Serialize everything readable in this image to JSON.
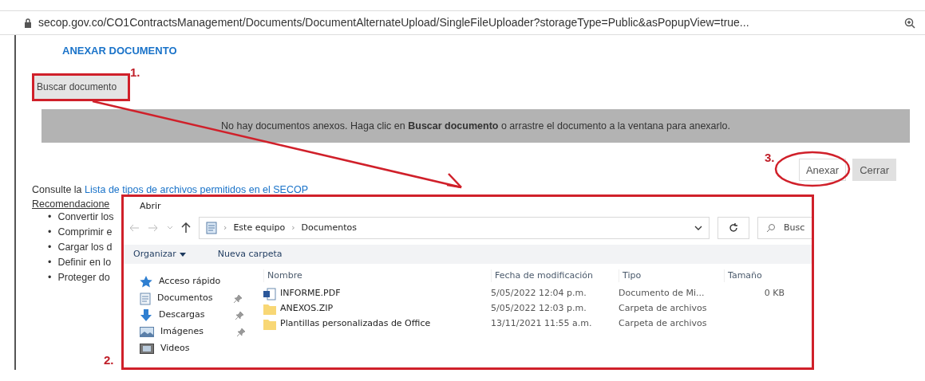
{
  "browser": {
    "url": "secop.gov.co/CO1ContractsManagement/Documents/DocumentAlternateUpload/SingleFileUploader?storageType=Public&asPopupView=true..."
  },
  "page": {
    "title": "ANEXAR DOCUMENTO",
    "browse_button": "Buscar documento",
    "empty_message": "No hay documentos anexos. Haga clic en **Buscar documento** o arrastre el documento a la ventana para anexarlo.",
    "buttons": [
      {
        "label": "Anexar",
        "kind": "outline"
      },
      {
        "label": "Cerrar",
        "kind": "plain"
      }
    ],
    "info_prefix": "Consulte la",
    "info_link": "Lista de tipos de archivos permitidos en el SECOP",
    "recommendations_heading": "Recomendacione",
    "recommendations": [
      {
        "bullet": "•",
        "text": "Convertir los"
      },
      {
        "bullet": "•",
        "text": "Comprimir e"
      },
      {
        "bullet": "•",
        "text": "Cargar los d"
      },
      {
        "bullet": "•",
        "text": "Definir en lo"
      },
      {
        "bullet": "•",
        "text": "Proteger do"
      }
    ]
  },
  "dialog": {
    "title": "Abrir",
    "path": [
      {
        "separator": "›",
        "label": "Este equipo"
      },
      {
        "separator": "›",
        "label": "Documentos"
      }
    ],
    "search_placeholder": "Busc",
    "toolbar": [
      {
        "label": "Organizar",
        "dropdown": true
      },
      {
        "label": "Nueva carpeta",
        "dropdown": false
      }
    ],
    "nav": [
      {
        "label": "Acceso rápido",
        "kind": "star",
        "pinned": false
      },
      {
        "label": "Documentos",
        "kind": "document",
        "pinned": true
      },
      {
        "label": "Descargas",
        "kind": "download",
        "pinned": true
      },
      {
        "label": "Imágenes",
        "kind": "image",
        "pinned": true
      },
      {
        "label": "Videos",
        "kind": "video",
        "pinned": false
      }
    ],
    "columns": [
      "Nombre",
      "Fecha de modificación",
      "Tipo",
      "Tamaño"
    ],
    "files": [
      {
        "kind": "word",
        "name": "INFORME.PDF",
        "modified": "5/05/2022 12:04 p.m.",
        "type": "Documento de Mi...",
        "size": "0 KB"
      },
      {
        "kind": "folder",
        "name": "ANEXOS.ZIP",
        "modified": "5/05/2022 12:03 p.m.",
        "type": "Carpeta de archivos"
      },
      {
        "kind": "folder",
        "name": "Plantillas personalizadas de Office",
        "modified": "13/11/2021 11:55 a.m.",
        "type": "Carpeta de archivos"
      }
    ]
  },
  "markers": [
    "1.",
    "2.",
    "3."
  ]
}
